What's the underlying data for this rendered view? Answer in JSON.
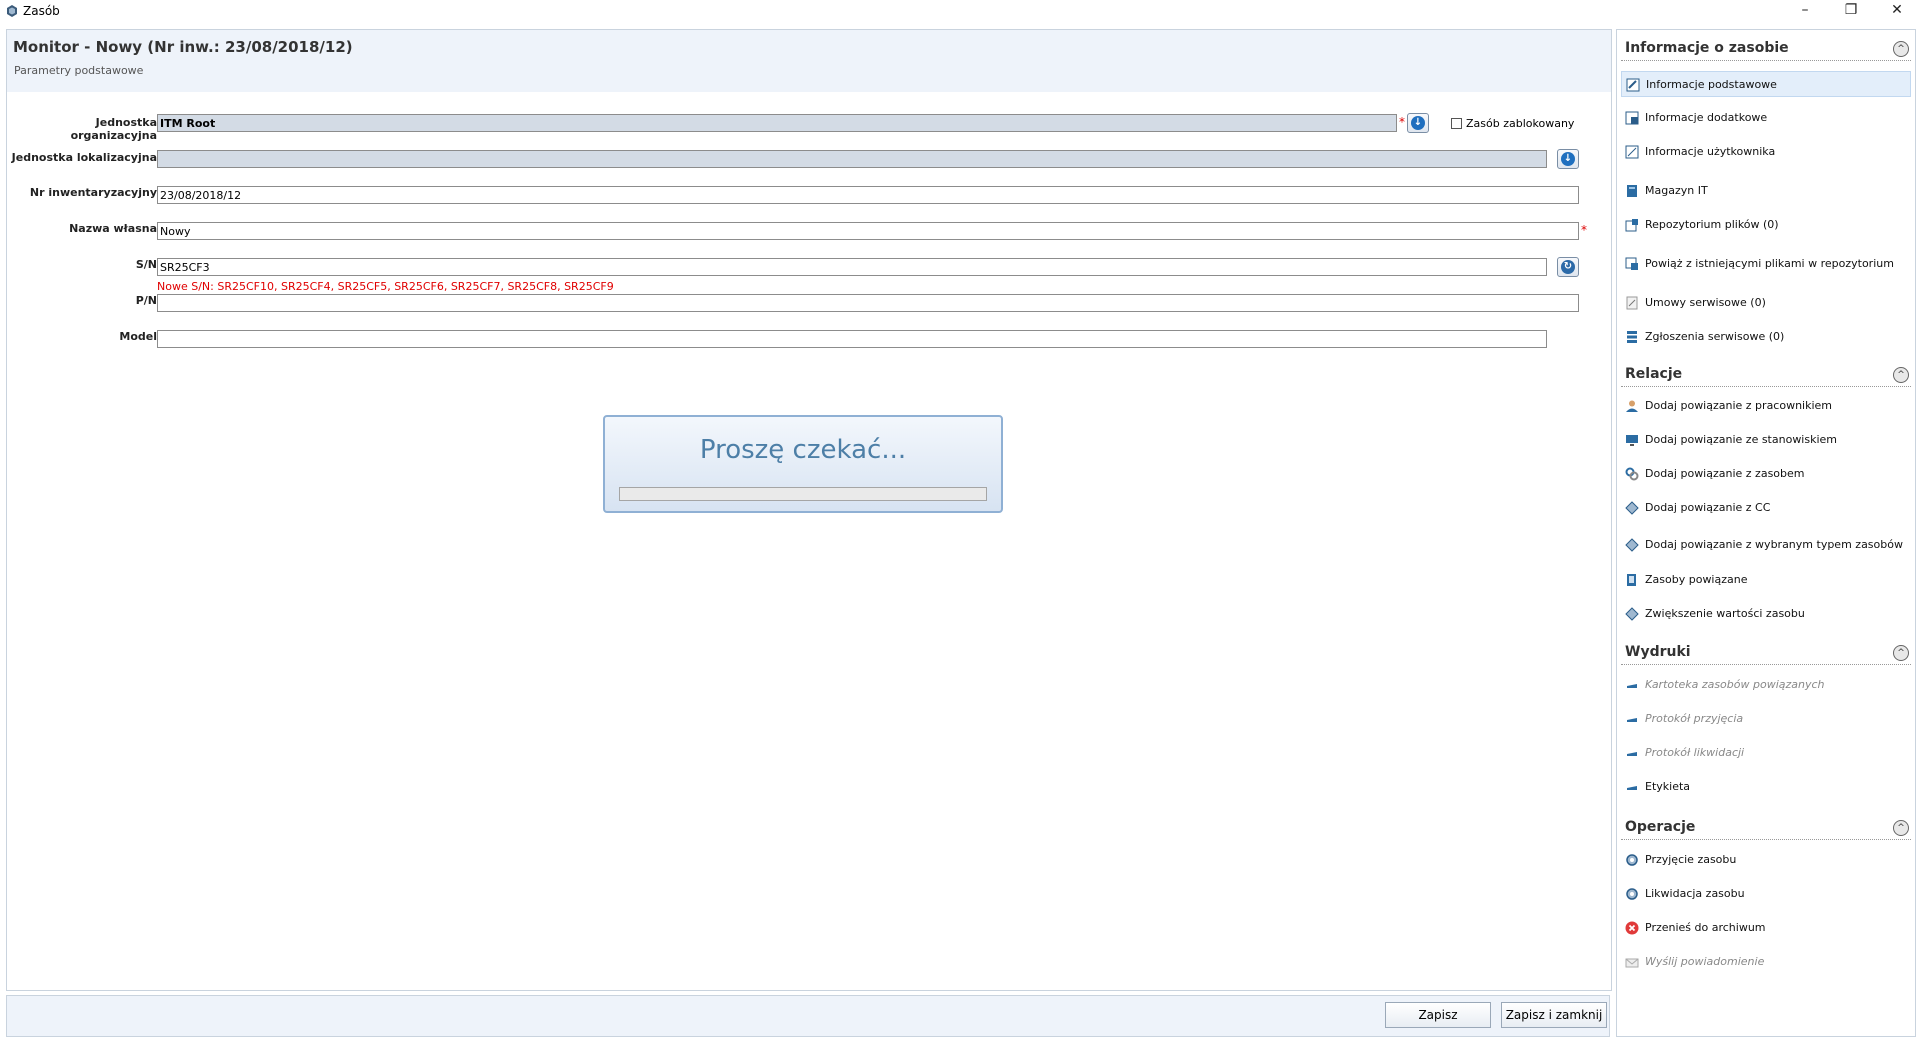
{
  "window": {
    "title": "Zasób",
    "minimize": "–",
    "restore": "❐",
    "close": "✕"
  },
  "main": {
    "title": "Monitor - Nowy (Nr inw.: 23/08/2018/12)",
    "subtitle": "Parametry podstawowe"
  },
  "form": {
    "org_unit_label": "Jednostka organizacyjna",
    "org_unit_value": "ITM Root",
    "loc_unit_label": "Jednostka lokalizacyjna",
    "loc_unit_value": "",
    "inventory_label": "Nr inwentaryzacyjny",
    "inventory_value": "23/08/2018/12",
    "name_label": "Nazwa własna",
    "name_value": "Nowy",
    "sn_label": "S/N",
    "sn_value": "SR25CF3",
    "sn_hint": "Nowe S/N: SR25CF10, SR25CF4, SR25CF5, SR25CF6, SR25CF7, SR25CF8, SR25CF9",
    "pn_label": "P/N",
    "pn_value": "",
    "model_label": "Model",
    "model_value": "",
    "locked_label": "Zasób zablokowany",
    "required_mark": "*"
  },
  "wait": {
    "text": "Proszę czekać..."
  },
  "footer": {
    "save": "Zapisz",
    "save_close": "Zapisz i zamknij"
  },
  "side": {
    "info": {
      "header": "Informacje o zasobie",
      "items": [
        "Informacje podstawowe",
        "Informacje dodatkowe",
        "Informacje użytkownika",
        "Magazyn IT",
        "Repozytorium plików (0)",
        "Powiąż z istniejącymi plikami w repozytorium",
        "Umowy serwisowe (0)",
        "Zgłoszenia serwisowe (0)"
      ]
    },
    "relations": {
      "header": "Relacje",
      "items": [
        "Dodaj powiązanie z pracownikiem",
        "Dodaj powiązanie ze stanowiskiem",
        "Dodaj powiązanie z zasobem",
        "Dodaj powiązanie z CC",
        "Dodaj powiązanie z wybranym typem zasobów",
        "Zasoby powiązane",
        "Zwiększenie wartości zasobu"
      ]
    },
    "prints": {
      "header": "Wydruki",
      "items": [
        "Kartoteka zasobów powiązanych",
        "Protokół przyjęcia",
        "Protokół likwidacji",
        "Etykieta"
      ]
    },
    "operations": {
      "header": "Operacje",
      "items": [
        "Przyjęcie zasobu",
        "Likwidacja zasobu",
        "Przenieś do archiwum",
        "Wyślij powiadomienie"
      ]
    },
    "collapse_glyph": "^"
  }
}
